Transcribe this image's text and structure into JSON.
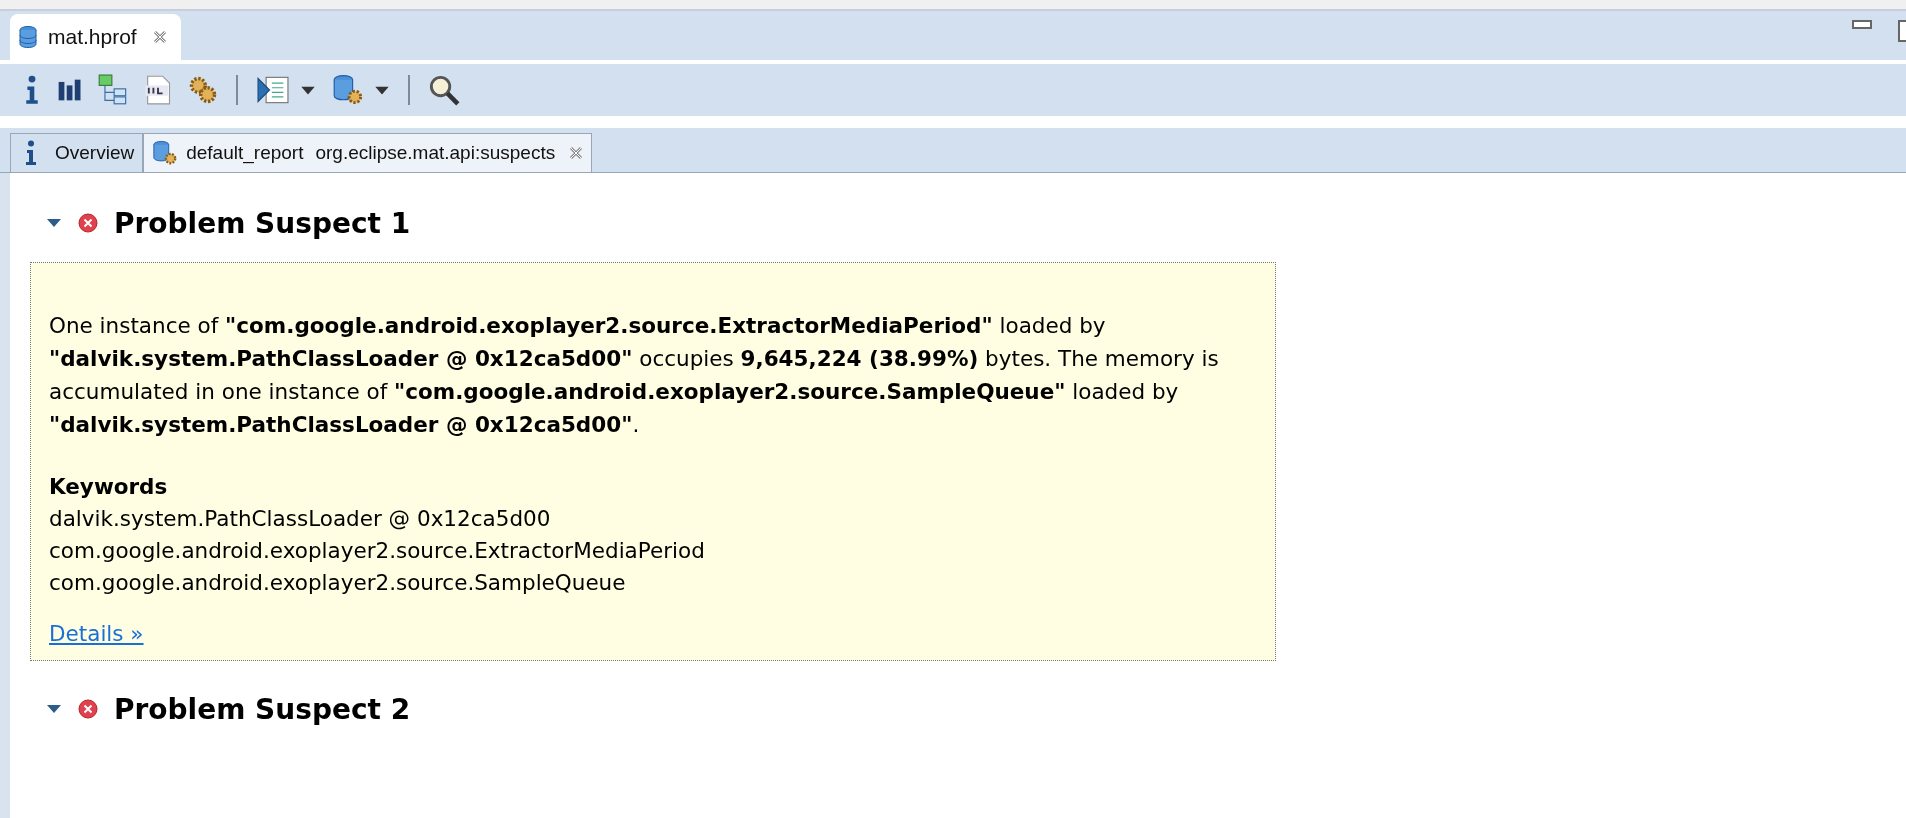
{
  "editor_tabs": [
    {
      "label": "mat.hprof",
      "selected": true
    }
  ],
  "report_tabs": [
    {
      "kind": "info",
      "label": "Overview",
      "selected": false
    },
    {
      "kind": "report",
      "label": "default_report",
      "detail": "org.eclipse.mat.api:suspects",
      "selected": true
    }
  ],
  "suspects": [
    {
      "title": "Problem Suspect 1",
      "expanded": true,
      "description": "One instance of **\"com.google.android.exoplayer2.source.ExtractorMediaPeriod\"** loaded by **\"dalvik.system.PathClassLoader @ 0x12ca5d00\"** occupies **9,645,224 (38.99%)** bytes. The memory is accumulated in one instance of **\"com.google.android.exoplayer2.source.SampleQueue\"** loaded by **\"dalvik.system.PathClassLoader @ 0x12ca5d00\"**.",
      "keywords_heading": "Keywords",
      "keywords": [
        "dalvik.system.PathClassLoader @ 0x12ca5d00",
        "com.google.android.exoplayer2.source.ExtractorMediaPeriod",
        "com.google.android.exoplayer2.source.SampleQueue"
      ],
      "link": "Details »"
    },
    {
      "title": "Problem Suspect 2",
      "expanded": true
    }
  ]
}
